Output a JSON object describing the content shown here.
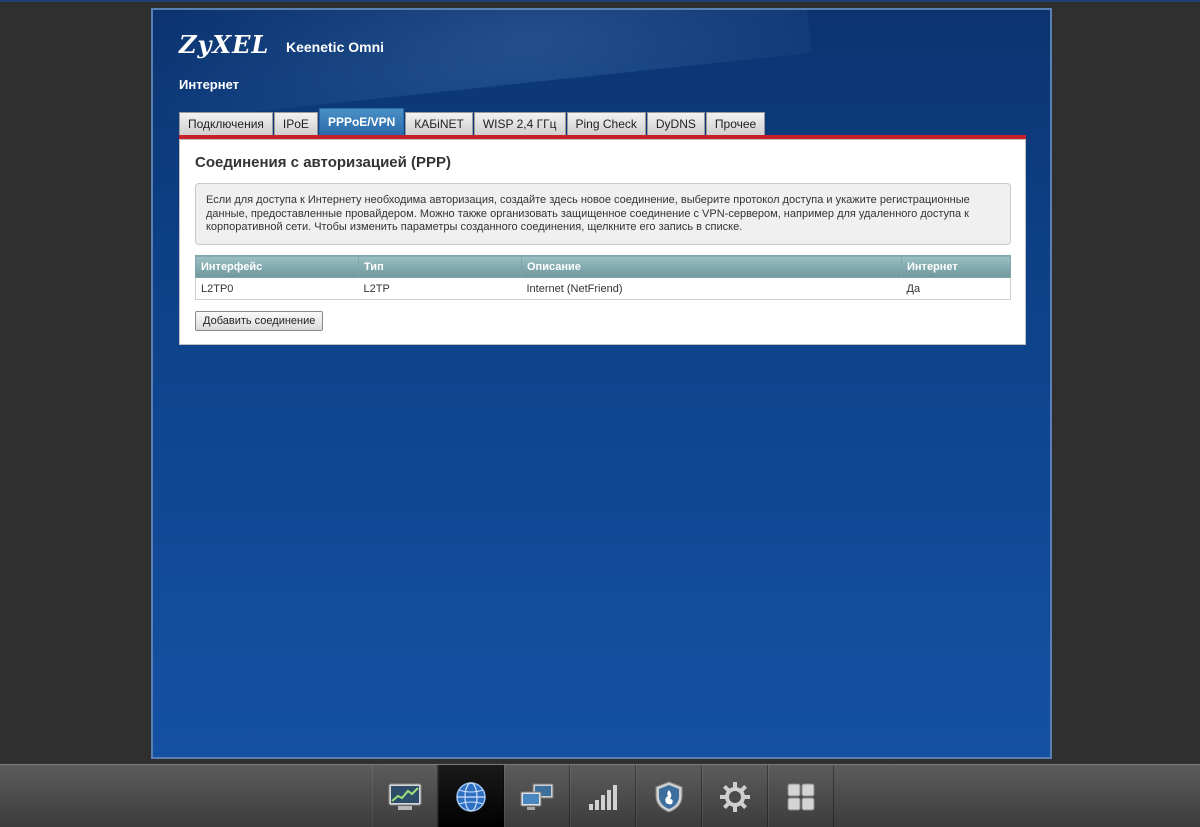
{
  "header": {
    "brand": "ZyXEL",
    "model": "Keenetic Omni",
    "section": "Интернет"
  },
  "tabs": [
    {
      "label": "Подключения",
      "active": false
    },
    {
      "label": "IPoE",
      "active": false
    },
    {
      "label": "PPPoE/VPN",
      "active": true
    },
    {
      "label": "КАБiNET",
      "active": false
    },
    {
      "label": "WISP 2,4 ГГц",
      "active": false
    },
    {
      "label": "Ping Check",
      "active": false
    },
    {
      "label": "DyDNS",
      "active": false
    },
    {
      "label": "Прочее",
      "active": false
    }
  ],
  "panel": {
    "title": "Соединения с авторизацией (PPP)",
    "info": "Если для доступа к Интернету необходима авторизация, создайте здесь новое соединение, выберите протокол доступа и укажите регистрационные данные, предоставленные провайдером. Можно также организовать защищенное соединение с VPN-сервером, например для удаленного доступа к корпоративной сети. Чтобы изменить параметры созданного соединения, щелкните его запись в списке.",
    "table": {
      "headers": [
        "Интерфейс",
        "Тип",
        "Описание",
        "Интернет"
      ],
      "rows": [
        [
          "L2TP0",
          "L2TP",
          "Internet (NetFriend)",
          "Да"
        ]
      ]
    },
    "add_button": "Добавить соединение"
  },
  "taskbar": {
    "items": [
      {
        "icon": "monitor-chart-icon",
        "active": false
      },
      {
        "icon": "globe-icon",
        "active": true
      },
      {
        "icon": "network-computers-icon",
        "active": false
      },
      {
        "icon": "wifi-signal-bars-icon",
        "active": false
      },
      {
        "icon": "shield-icon",
        "active": false
      },
      {
        "icon": "gear-icon",
        "active": false
      },
      {
        "icon": "apps-grid-icon",
        "active": false
      }
    ]
  },
  "colors": {
    "frame_blue": "#0d3f85",
    "active_tab": "#2a6aa8",
    "accent_red": "#c8202a",
    "table_header": "#7ea6ab"
  }
}
